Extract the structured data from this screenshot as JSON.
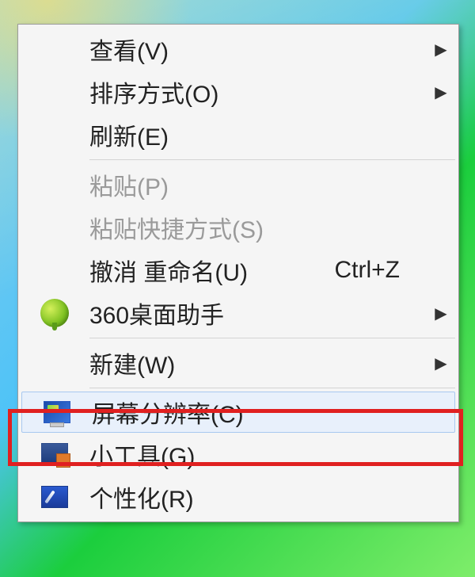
{
  "menu": {
    "items": [
      {
        "label": "查看(V)",
        "has_submenu": true
      },
      {
        "label": "排序方式(O)",
        "has_submenu": true
      },
      {
        "label": "刷新(E)"
      },
      {
        "sep": true
      },
      {
        "label": "粘贴(P)",
        "disabled": true
      },
      {
        "label": "粘贴快捷方式(S)",
        "disabled": true
      },
      {
        "label": "撤消 重命名(U)",
        "shortcut": "Ctrl+Z"
      },
      {
        "label": "360桌面助手",
        "icon": "360",
        "has_submenu": true
      },
      {
        "sep": true
      },
      {
        "label": "新建(W)",
        "has_submenu": true
      },
      {
        "sep": true
      },
      {
        "label": "屏幕分辨率(C)",
        "icon": "screen",
        "highlighted": true
      },
      {
        "label": "小工具(G)",
        "icon": "gadget"
      },
      {
        "label": "个性化(R)",
        "icon": "personalize"
      }
    ]
  },
  "arrow_glyph": "▶"
}
